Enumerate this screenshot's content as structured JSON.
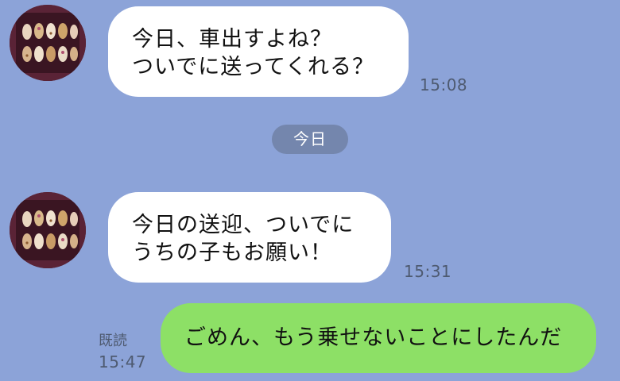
{
  "messages": [
    {
      "side": "left",
      "lines": [
        "今日、車出すよね？",
        "ついでに送ってくれる？"
      ],
      "time": "15:08"
    },
    {
      "side": "left",
      "lines": [
        "今日の送迎、ついでに",
        "うちの子もお願い！"
      ],
      "time": "15:31"
    },
    {
      "side": "right",
      "lines": [
        "ごめん、もう乗せないことにしたんだ"
      ],
      "time": "15:47",
      "read_label": "既読"
    }
  ],
  "date_separator": "今日",
  "colors": {
    "background": "#8ca3d8",
    "incoming_bubble": "#ffffff",
    "outgoing_bubble": "#8de066",
    "date_pill": "#7486ad"
  },
  "avatar": {
    "icon": "nail-art-avatar-icon"
  }
}
